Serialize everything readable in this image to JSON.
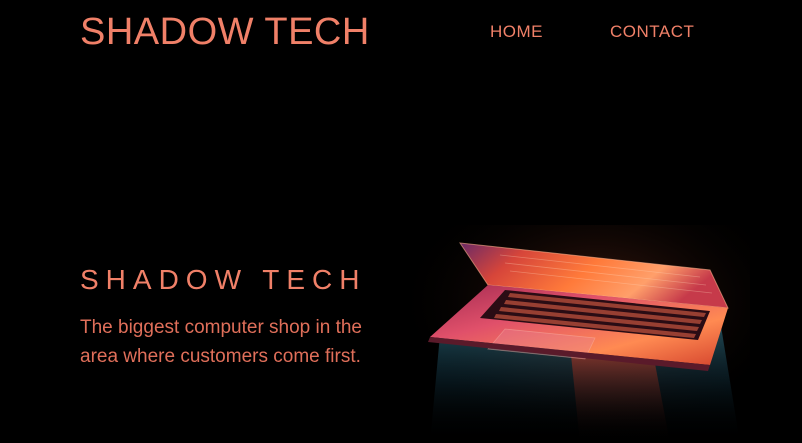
{
  "header": {
    "brand": "SHADOW TECH",
    "nav": [
      {
        "label": "HOME"
      },
      {
        "label": "CONTACT"
      }
    ]
  },
  "hero": {
    "title": "SHADOW TECH",
    "text": "The biggest computer shop in the area where customers come first.",
    "image": "laptop-photo"
  },
  "colors": {
    "background": "#000000",
    "accent": "#f08068"
  }
}
